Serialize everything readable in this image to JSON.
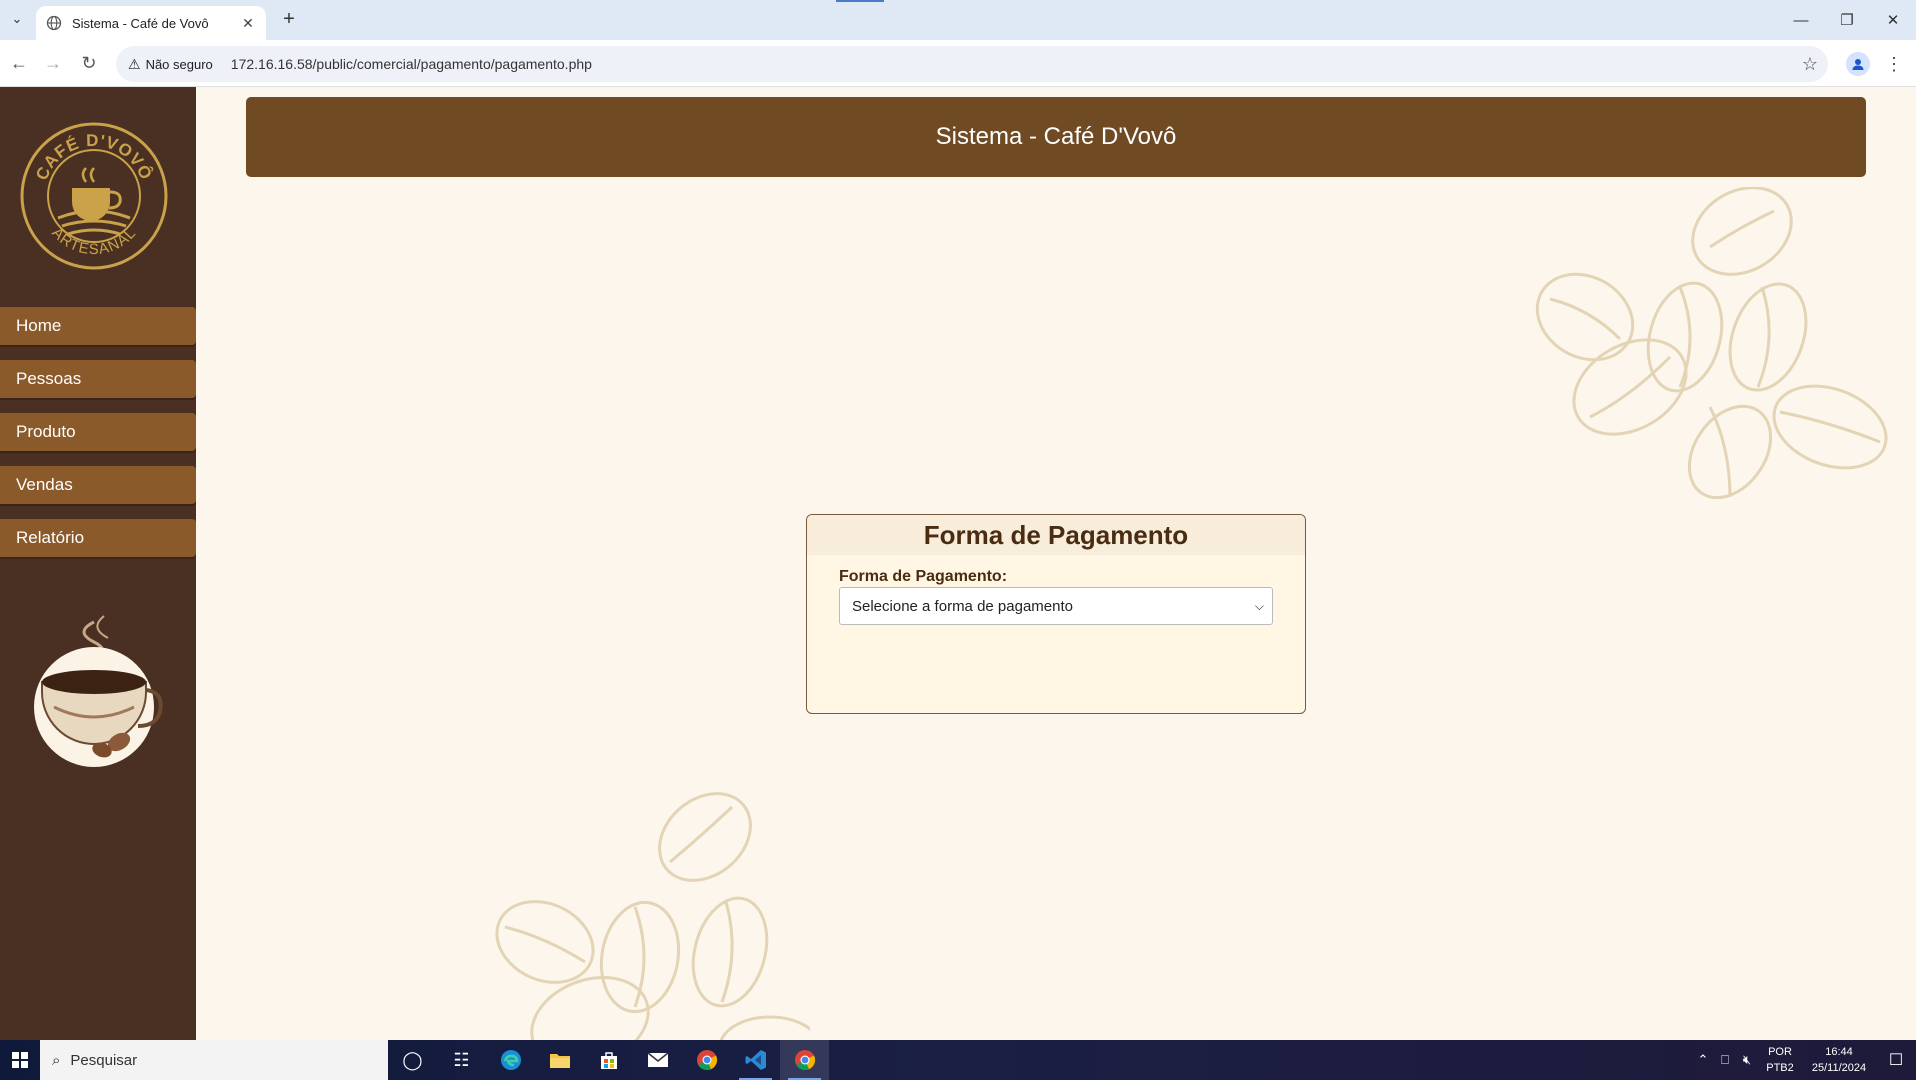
{
  "browser": {
    "tab_title": "Sistema - Café de Vovô",
    "not_secure_label": "Não seguro",
    "url": "172.16.16.58/public/comercial/pagamento/pagamento.php"
  },
  "sidebar": {
    "logo_text_top": "CAFÉ D'VOVÔ",
    "logo_text_bottom": "ARTESANAL",
    "items": [
      {
        "label": "Home"
      },
      {
        "label": "Pessoas"
      },
      {
        "label": "Produto"
      },
      {
        "label": "Vendas"
      },
      {
        "label": "Relatório"
      }
    ]
  },
  "header": {
    "title": "Sistema - Café D'Vovô"
  },
  "card": {
    "title": "Forma de Pagamento",
    "field_label": "Forma de Pagamento:",
    "select_value": "Selecione a forma de pagamento"
  },
  "taskbar": {
    "search_placeholder": "Pesquisar",
    "lang_line1": "POR",
    "lang_line2": "PTB2",
    "time": "16:44",
    "date": "25/11/2024"
  },
  "colors": {
    "sidebar_bg": "#4a3022",
    "menu_item_bg": "#8b5a2b",
    "header_bg": "#6f4a23",
    "page_bg": "#fdf6ec",
    "card_bg": "#fff7e4",
    "title_text": "#4a2c12"
  }
}
